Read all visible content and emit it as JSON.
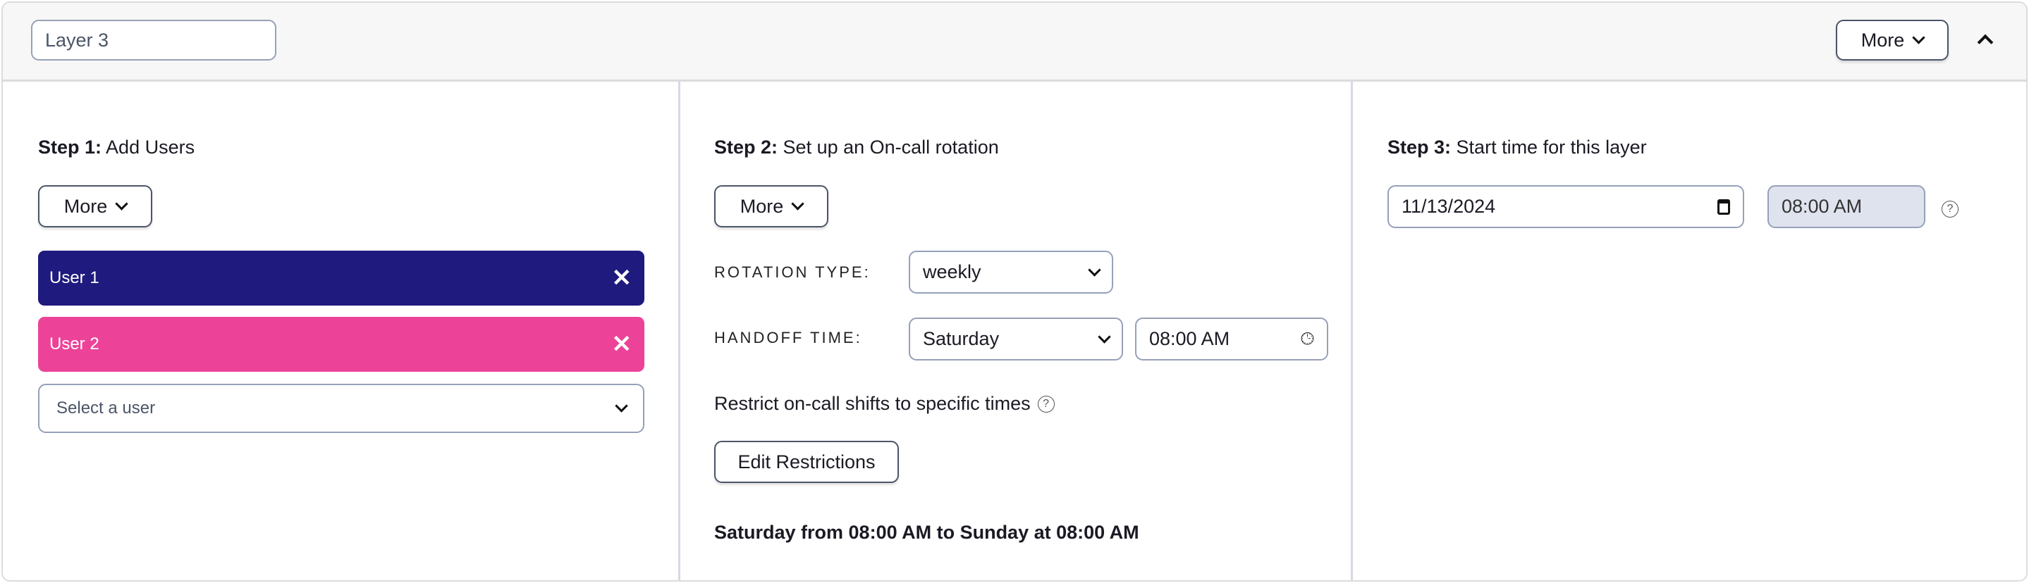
{
  "header": {
    "layer_name": "Layer 3",
    "more_label": "More"
  },
  "step1": {
    "prefix": "Step 1:",
    "title": "Add Users",
    "more_label": "More",
    "users": [
      {
        "name": "User 1",
        "color": "#1f1a7e"
      },
      {
        "name": "User 2",
        "color": "#ec4399"
      }
    ],
    "select_placeholder": "Select a user"
  },
  "step2": {
    "prefix": "Step 2:",
    "title": "Set up an On-call rotation",
    "more_label": "More",
    "rotation_type_label": "ROTATION TYPE:",
    "rotation_type": "weekly",
    "handoff_label": "HANDOFF TIME:",
    "handoff_day": "Saturday",
    "handoff_time": "08:00 AM",
    "restrict_label": "Restrict on-call shifts to specific times",
    "edit_restrictions": "Edit Restrictions",
    "summary": "Saturday from 08:00 AM to Sunday at 08:00 AM"
  },
  "step3": {
    "prefix": "Step 3:",
    "title": "Start time for this layer",
    "date": "11/13/2024",
    "time": "08:00 AM"
  }
}
